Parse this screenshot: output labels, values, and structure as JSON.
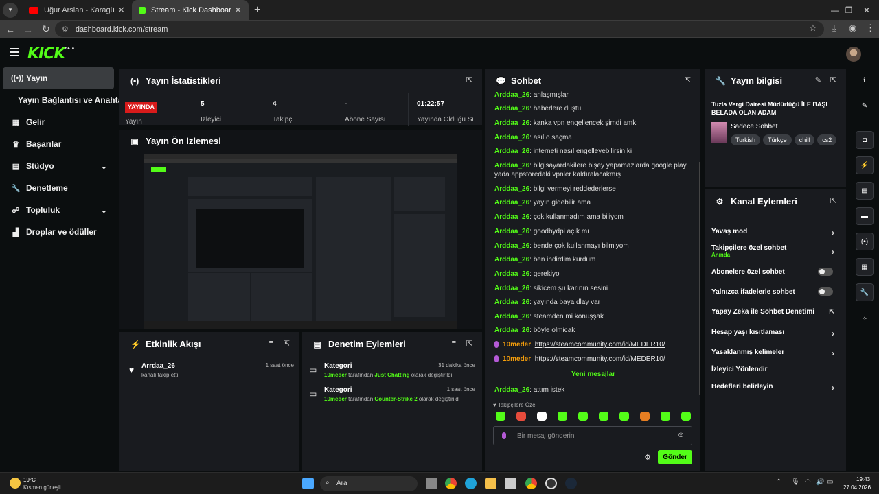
{
  "browser": {
    "tabs": [
      {
        "title": "Uğur Arslan - Karagümrük Yangı",
        "favicon_color": "#ff0000"
      },
      {
        "title": "Stream - Kick Dashboard",
        "favicon_color": "#53fc18"
      }
    ],
    "url": "dashboard.kick.com/stream"
  },
  "app": {
    "logo": "KICK",
    "logo_badge": "BETA",
    "accent": "#53fc18"
  },
  "sidebar": {
    "items": [
      {
        "label": "Yayın",
        "icon": "broadcast-icon"
      },
      {
        "label": "Yayın Bağlantısı ve Anahtarı",
        "icon": ""
      },
      {
        "label": "Gelir",
        "icon": "revenue-icon"
      },
      {
        "label": "Başarılar",
        "icon": "trophy-icon"
      },
      {
        "label": "Stüdyo",
        "icon": "studio-icon"
      },
      {
        "label": "Denetleme",
        "icon": "wrench-icon"
      },
      {
        "label": "Topluluk",
        "icon": "community-icon"
      },
      {
        "label": "Droplar ve ödüller",
        "icon": "drops-icon"
      }
    ]
  },
  "stats": {
    "title": "Yayın İstatistikleri",
    "live_badge": "YAYINDA",
    "items": [
      {
        "value": "",
        "label": "Yayın"
      },
      {
        "value": "5",
        "label": "İzleyici"
      },
      {
        "value": "4",
        "label": "Takipçi"
      },
      {
        "value": "-",
        "label": "Abone Sayısı"
      },
      {
        "value": "01:22:57",
        "label": "Yayında Olduğu Süre"
      }
    ]
  },
  "preview": {
    "title": "Yayın Ön İzlemesi"
  },
  "activity": {
    "title": "Etkinlik Akışı",
    "items": [
      {
        "user": "Arrdaa_26",
        "desc": "kanalı takip etti",
        "time": "1 saat önce"
      }
    ]
  },
  "mod_actions": {
    "title": "Denetim Eylemleri",
    "items": [
      {
        "title": "Kategori",
        "time": "31 dakika önce",
        "user": "10meder",
        "mid": "tarafından",
        "category": "Just Chatting",
        "end": "olarak değiştirildi"
      },
      {
        "title": "Kategori",
        "time": "1 saat önce",
        "user": "10meder",
        "mid": "tarafından",
        "category": "Counter-Strike 2",
        "end": "olarak değiştirildi"
      }
    ]
  },
  "chat": {
    "title": "Sohbet",
    "messages": [
      {
        "user": "Arddaa_26",
        "text": "anlaşmışlar"
      },
      {
        "user": "Arddaa_26",
        "text": "haberlere düştü"
      },
      {
        "user": "Arddaa_26",
        "text": "kanka vpn engellencek şimdi amk"
      },
      {
        "user": "Arddaa_26",
        "text": "asıl o saçma"
      },
      {
        "user": "Arddaa_26",
        "text": "interneti nasıl engelleyebilirsin ki"
      },
      {
        "user": "Arddaa_26",
        "text": "bilgisayardakilere bişey yapamazlarda google play yada appstoredaki vpnler kaldıralacakmış"
      },
      {
        "user": "Arddaa_26",
        "text": "bilgi vermeyi reddederlerse"
      },
      {
        "user": "Arddaa_26",
        "text": "yayın gidebilir ama"
      },
      {
        "user": "Arddaa_26",
        "text": "çok kullanmadım ama biliyom"
      },
      {
        "user": "Arddaa_26",
        "text": "goodbydpi açık mı"
      },
      {
        "user": "Arddaa_26",
        "text": "bende çok kullanmayı bilmiyom"
      },
      {
        "user": "Arddaa_26",
        "text": "ben indirdim kurdum"
      },
      {
        "user": "Arddaa_26",
        "text": "gerekiyo"
      },
      {
        "user": "Arddaa_26",
        "text": "sikicem şu karının sesini"
      },
      {
        "user": "Arddaa_26",
        "text": "yayında baya dlay var"
      },
      {
        "user": "Arddaa_26",
        "text": "steamden mi konuşşak"
      },
      {
        "user": "Arddaa_26",
        "text": "böyle olmicak"
      },
      {
        "user": "10meder",
        "text": "https://steamcommunity.com/id/MEDER10/",
        "link": true
      },
      {
        "user": "10meder",
        "text": "https://steamcommunity.com/id/MEDER10/",
        "link": true
      }
    ],
    "new_messages_label": "Yeni mesajlar",
    "after_messages": [
      {
        "user": "Arddaa_26",
        "text": "attım istek"
      }
    ],
    "followers_only": "Takipçilere Özel",
    "input_placeholder": "Bir mesaj gönderin",
    "send_label": "Gönder"
  },
  "stream_info": {
    "title": "Yayın bilgisi",
    "stream_title": "Tuzla Vergi Dairesi Müdürlüğü İLE BAŞI BELADA OLAN ADAM",
    "category": "Sadece Sohbet",
    "tags": [
      "Turkish",
      "Türkçe",
      "chill",
      "cs2"
    ]
  },
  "channel_actions": {
    "title": "Kanal Eylemleri",
    "items": [
      {
        "label": "Yavaş mod",
        "control": "arrow"
      },
      {
        "label": "Takipçilere özel sohbet",
        "sub": "Anında",
        "control": "arrow"
      },
      {
        "label": "Abonelere özel sohbet",
        "control": "toggle"
      },
      {
        "label": "Yalnızca ifadelerle sohbet",
        "control": "toggle"
      },
      {
        "label": "Yapay Zeka ile Sohbet Denetimi",
        "control": "external"
      },
      {
        "label": "Hesap yaşı kısıtlaması",
        "control": "arrow"
      },
      {
        "label": "Yasaklanmış kelimeler",
        "control": "arrow"
      },
      {
        "label": "İzleyici Yönlendir",
        "control": "none"
      },
      {
        "label": "Hedefleri belirleyin",
        "control": "arrow"
      }
    ]
  },
  "taskbar": {
    "weather_temp": "19°C",
    "weather_desc": "Kısmen güneşli",
    "search_label": "Ara",
    "time": "19:43",
    "date": "27.04.2026"
  }
}
